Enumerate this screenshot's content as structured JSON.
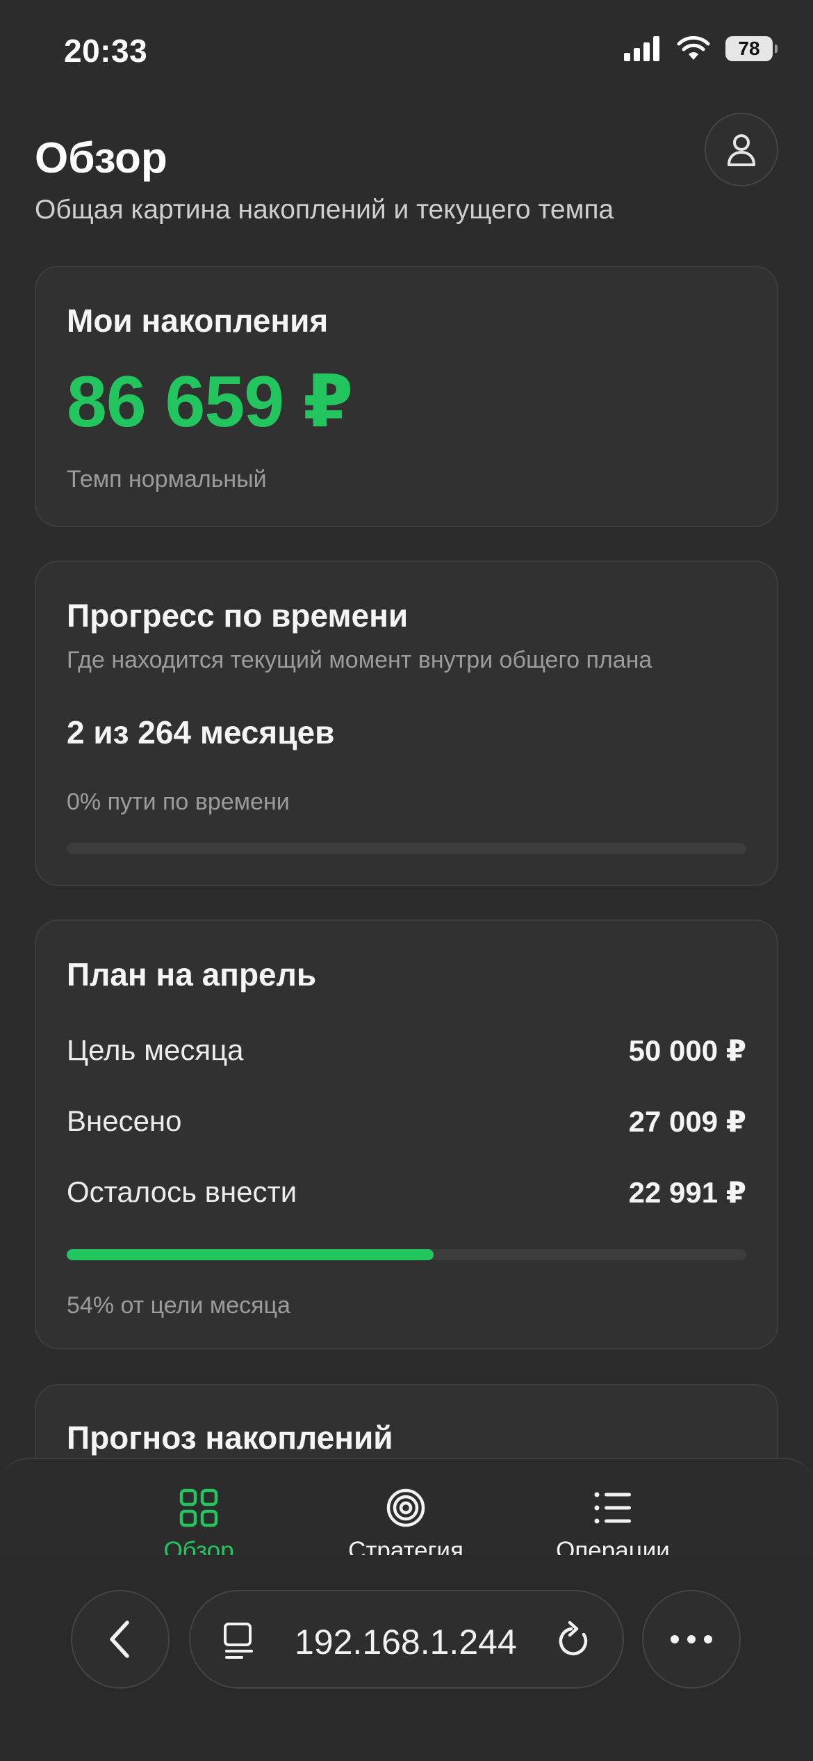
{
  "status_bar": {
    "time": "20:33",
    "battery": "78"
  },
  "header": {
    "title": "Обзор",
    "subtitle": "Общая картина накоплений и текущего темпа"
  },
  "savings": {
    "title": "Мои накопления",
    "amount": "86 659 ₽",
    "status": "Темп нормальный"
  },
  "time_progress": {
    "title": "Прогресс по времени",
    "subtitle": "Где находится текущий момент внутри общего плана",
    "months": "2 из 264 месяцев",
    "caption": "0% пути по времени",
    "fraction": 0.0
  },
  "month_plan": {
    "title": "План на апрель",
    "rows": [
      {
        "label": "Цель месяца",
        "value": "50 000 ₽"
      },
      {
        "label": "Внесено",
        "value": "27 009 ₽"
      },
      {
        "label": "Осталось внести",
        "value": "22 991 ₽"
      }
    ],
    "fraction": 0.54,
    "caption": "54% от цели месяца"
  },
  "forecast": {
    "title": "Прогноз накоплений"
  },
  "tabs": [
    {
      "label": "Обзор",
      "icon": "grid-icon",
      "active": true
    },
    {
      "label": "Стратегия",
      "icon": "target-icon",
      "active": false
    },
    {
      "label": "Операции",
      "icon": "list-icon",
      "active": false
    }
  ],
  "browser": {
    "url": "192.168.1.244"
  },
  "colors": {
    "accent": "#22c55e",
    "background": "#2c2c2c",
    "card": "#313131"
  }
}
